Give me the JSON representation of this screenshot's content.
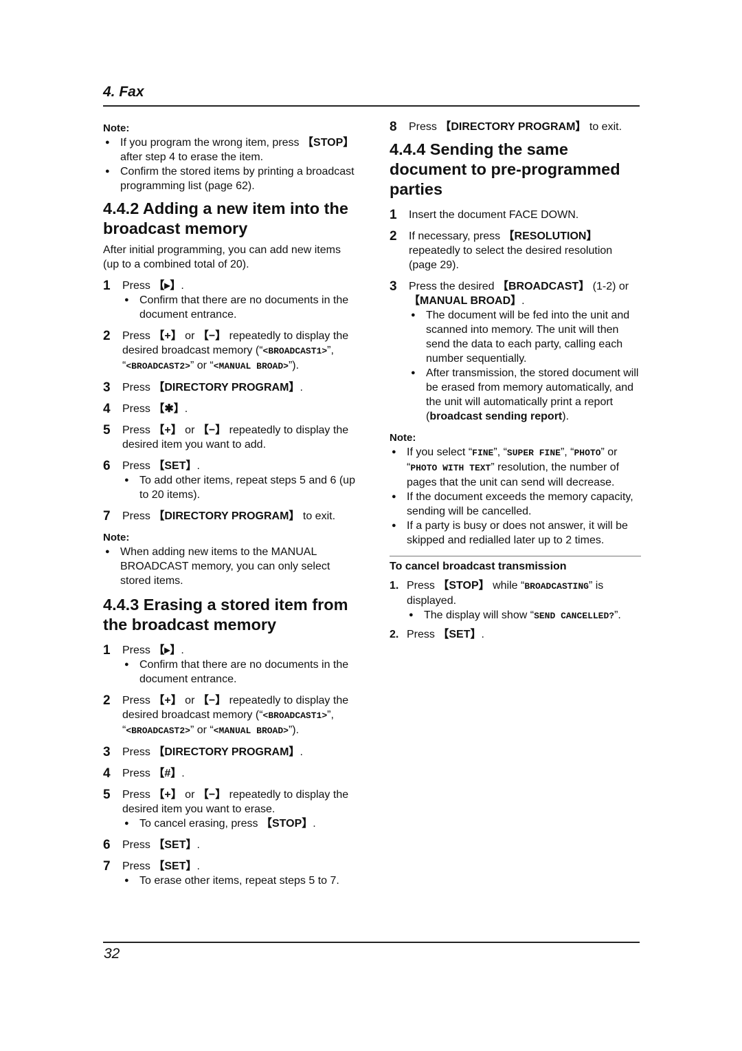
{
  "header": {
    "chapter": "4. Fax"
  },
  "footer": {
    "page_number": "32"
  },
  "left": {
    "note1": {
      "title": "Note:",
      "items": [
        {
          "pre": "If you program the wrong item, press ",
          "key": "STOP",
          "post": " after step 4 to erase the item."
        },
        {
          "pre": "Confirm the stored items by printing a broadcast programming list (page 62).",
          "key": "",
          "post": ""
        }
      ]
    },
    "s442": {
      "title": "4.4.2 Adding a new item into the broadcast memory",
      "intro": "After initial programming, you can add new items (up to a combined total of 20).",
      "steps": [
        {
          "num": "1",
          "pre": "Press ",
          "key": "▸",
          "post": ".",
          "bullet": "Confirm that there are no documents in the document entrance."
        },
        {
          "num": "2",
          "pre": "Press ",
          "key": "+",
          "mid": " or ",
          "key2": "−",
          "post": " repeatedly to display the desired broadcast memory (“",
          "m1": "<BROADCAST1>",
          "s1": "”, “",
          "m2": "<BROADCAST2>",
          "s2": "” or “",
          "m3": "<MANUAL BROAD>",
          "s3": "”)."
        },
        {
          "num": "3",
          "pre": "Press ",
          "key": "DIRECTORY PROGRAM",
          "post": "."
        },
        {
          "num": "4",
          "pre": "Press ",
          "key": "✱",
          "post": "."
        },
        {
          "num": "5",
          "pre": "Press ",
          "key": "+",
          "mid": " or ",
          "key2": "−",
          "post": " repeatedly to display the desired item you want to add."
        },
        {
          "num": "6",
          "pre": "Press ",
          "key": "SET",
          "post": ".",
          "bullet": "To add other items, repeat steps 5 and 6 (up to 20 items)."
        },
        {
          "num": "7",
          "pre": "Press ",
          "key": "DIRECTORY PROGRAM",
          "post": " to exit."
        }
      ],
      "note": {
        "title": "Note:",
        "text": "When adding new items to the MANUAL BROADCAST memory, you can only select stored items."
      }
    },
    "s443": {
      "title": "4.4.3 Erasing a stored item from the broadcast memory",
      "steps": [
        {
          "num": "1",
          "pre": "Press ",
          "key": "▸",
          "post": ".",
          "bullet": "Confirm that there are no documents in the document entrance."
        },
        {
          "num": "2",
          "pre": "Press ",
          "key": "+",
          "mid": " or ",
          "key2": "−",
          "post": " repeatedly to display the desired broadcast memory (“",
          "m1": "<BROADCAST1>",
          "s1": "”, “",
          "m2": "<BROADCAST2>",
          "s2": "” or “",
          "m3": "<MANUAL BROAD>",
          "s3": "”)."
        },
        {
          "num": "3",
          "pre": "Press ",
          "key": "DIRECTORY PROGRAM",
          "post": "."
        },
        {
          "num": "4",
          "pre": "Press ",
          "key": "#",
          "post": "."
        },
        {
          "num": "5",
          "pre": "Press ",
          "key": "+",
          "mid": " or ",
          "key2": "−",
          "post": " repeatedly to display the desired item you want to erase.",
          "bullet_pre": "To cancel erasing, press ",
          "bullet_key": "STOP",
          "bullet_post": "."
        },
        {
          "num": "6",
          "pre": "Press ",
          "key": "SET",
          "post": "."
        },
        {
          "num": "7",
          "pre": "Press ",
          "key": "SET",
          "post": ".",
          "bullet": "To erase other items, repeat steps 5 to 7."
        }
      ]
    }
  },
  "right": {
    "step8": {
      "num": "8",
      "pre": "Press ",
      "key": "DIRECTORY PROGRAM",
      "post": " to exit."
    },
    "s444": {
      "title": "4.4.4 Sending the same document to pre-programmed parties",
      "steps": [
        {
          "num": "1",
          "text": "Insert the document FACE DOWN."
        },
        {
          "num": "2",
          "pre": "If necessary, press ",
          "key": "RESOLUTION",
          "post": " repeatedly to select the desired resolution (page 29)."
        },
        {
          "num": "3",
          "pre": "Press the desired ",
          "key": "BROADCAST",
          "mid": " (1-2) or ",
          "key2": "MANUAL BROAD",
          "post": "."
        }
      ],
      "bullets": [
        {
          "text": "The document will be fed into the unit and scanned into memory. The unit will then send the data to each party, calling each number sequentially."
        },
        {
          "pre": "After transmission, the stored document will be erased from memory automatically, and the unit will automatically print a report (",
          "bold": "broadcast sending report",
          "post": ")."
        }
      ],
      "note": {
        "title": "Note:",
        "items": [
          {
            "pre": "If you select “",
            "m1": "FINE",
            "s1": "”, “",
            "m2": "SUPER FINE",
            "s2": "”, “",
            "m3": "PHOTO",
            "s3": "” or “",
            "m4": "PHOTO WITH TEXT",
            "post": "” resolution, the number of pages that the unit can send will decrease."
          },
          {
            "text": "If the document exceeds the memory capacity, sending will be cancelled."
          },
          {
            "text": "If a party is busy or does not answer, it will be skipped and redialled later up to 2 times."
          }
        ]
      }
    },
    "cancel": {
      "title": "To cancel broadcast transmission",
      "steps": [
        {
          "num": "1.",
          "pre": "Press ",
          "key": "STOP",
          "mid": " while “",
          "mono": "BROADCASTING",
          "post": "” is displayed.",
          "bullet_pre": "The display will show “",
          "bullet_mono": "SEND CANCELLED?",
          "bullet_post": "”."
        },
        {
          "num": "2.",
          "pre": "Press ",
          "key": "SET",
          "post": "."
        }
      ]
    }
  }
}
